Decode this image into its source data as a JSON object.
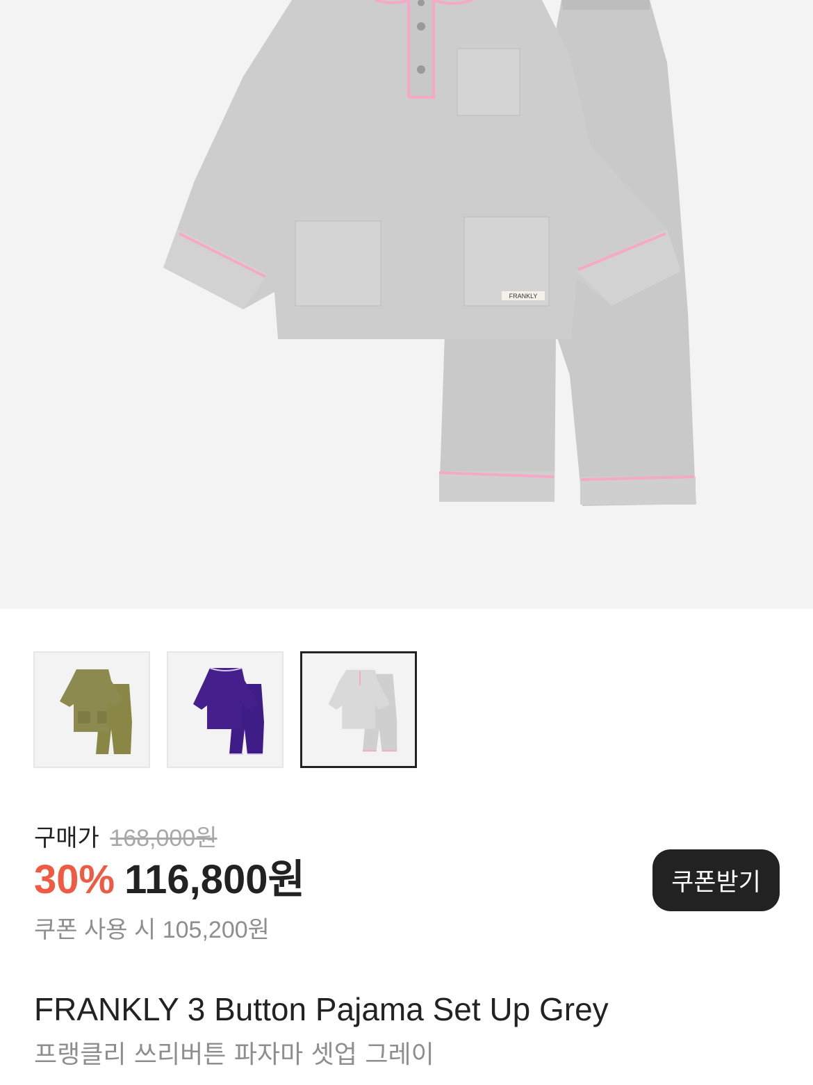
{
  "hero": {
    "brand_tag": "FRANKLY",
    "image_name": "grey-pajama-main-photo"
  },
  "thumbnails": [
    {
      "name": "thumbnail-olive-pajama",
      "color": "#8c8a4e",
      "selected": false
    },
    {
      "name": "thumbnail-purple-pajama",
      "color": "#45208d",
      "selected": false
    },
    {
      "name": "thumbnail-grey-pajama",
      "color": "#d9d9d9",
      "selected": true
    }
  ],
  "price": {
    "label": "구매가",
    "original": "168,000원",
    "discount_rate": "30%",
    "sale_price": "116,800원",
    "coupon_price_text": "쿠폰 사용 시 105,200원",
    "accent_color": "#ef5a42"
  },
  "coupon_button": {
    "label": "쿠폰받기"
  },
  "product": {
    "title_en": "FRANKLY 3 Button Pajama Set Up Grey",
    "title_ko": "프랭클리 쓰리버튼 파자마 셋업 그레이"
  }
}
